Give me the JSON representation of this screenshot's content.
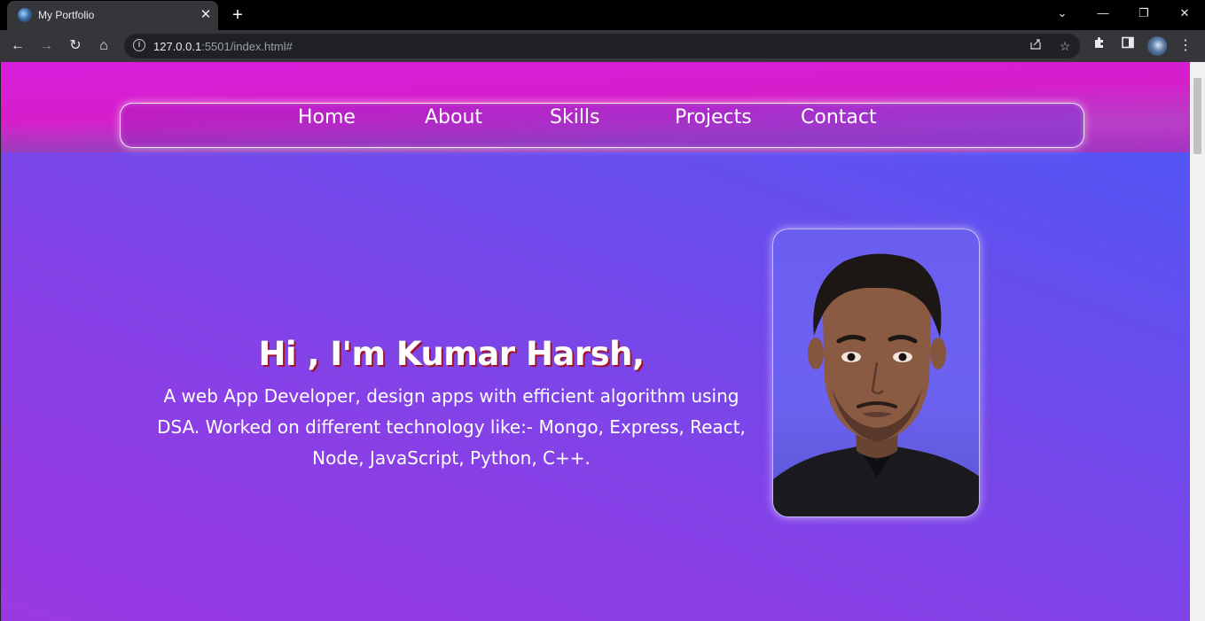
{
  "browser": {
    "tab": {
      "title": "My Portfolio",
      "close_glyph": "✕"
    },
    "new_tab_glyph": "+",
    "window_controls": {
      "tab_search": "⌄",
      "minimize": "—",
      "restore": "❐",
      "close": "✕"
    },
    "nav": {
      "back": "←",
      "forward": "→",
      "reload": "↻",
      "home": "⌂"
    },
    "address": {
      "host": "127.0.0.1",
      "rest": ":5501/index.html#"
    },
    "icons": [
      "share-icon",
      "star-icon",
      "extensions-icon",
      "side-panel-icon",
      "profile-avatar",
      "menu-icon"
    ]
  },
  "page": {
    "nav": {
      "items": [
        {
          "label": "Home"
        },
        {
          "label": "About"
        },
        {
          "label": "Skills"
        },
        {
          "label": "Projects"
        },
        {
          "label": "Contact"
        }
      ]
    },
    "hero": {
      "title": "Hi , I'm Kumar Harsh,",
      "description": "A web App Developer, design apps with efficient algorithm using DSA. Worked on different technology like:- Mongo, Express, React, Node, JavaScript, Python, C++."
    },
    "colors": {
      "nav_band": "#d81ddb",
      "background_top": "#4b58f7",
      "background_bottom": "#9a39e2",
      "title_shadow": "#a0142a"
    }
  }
}
